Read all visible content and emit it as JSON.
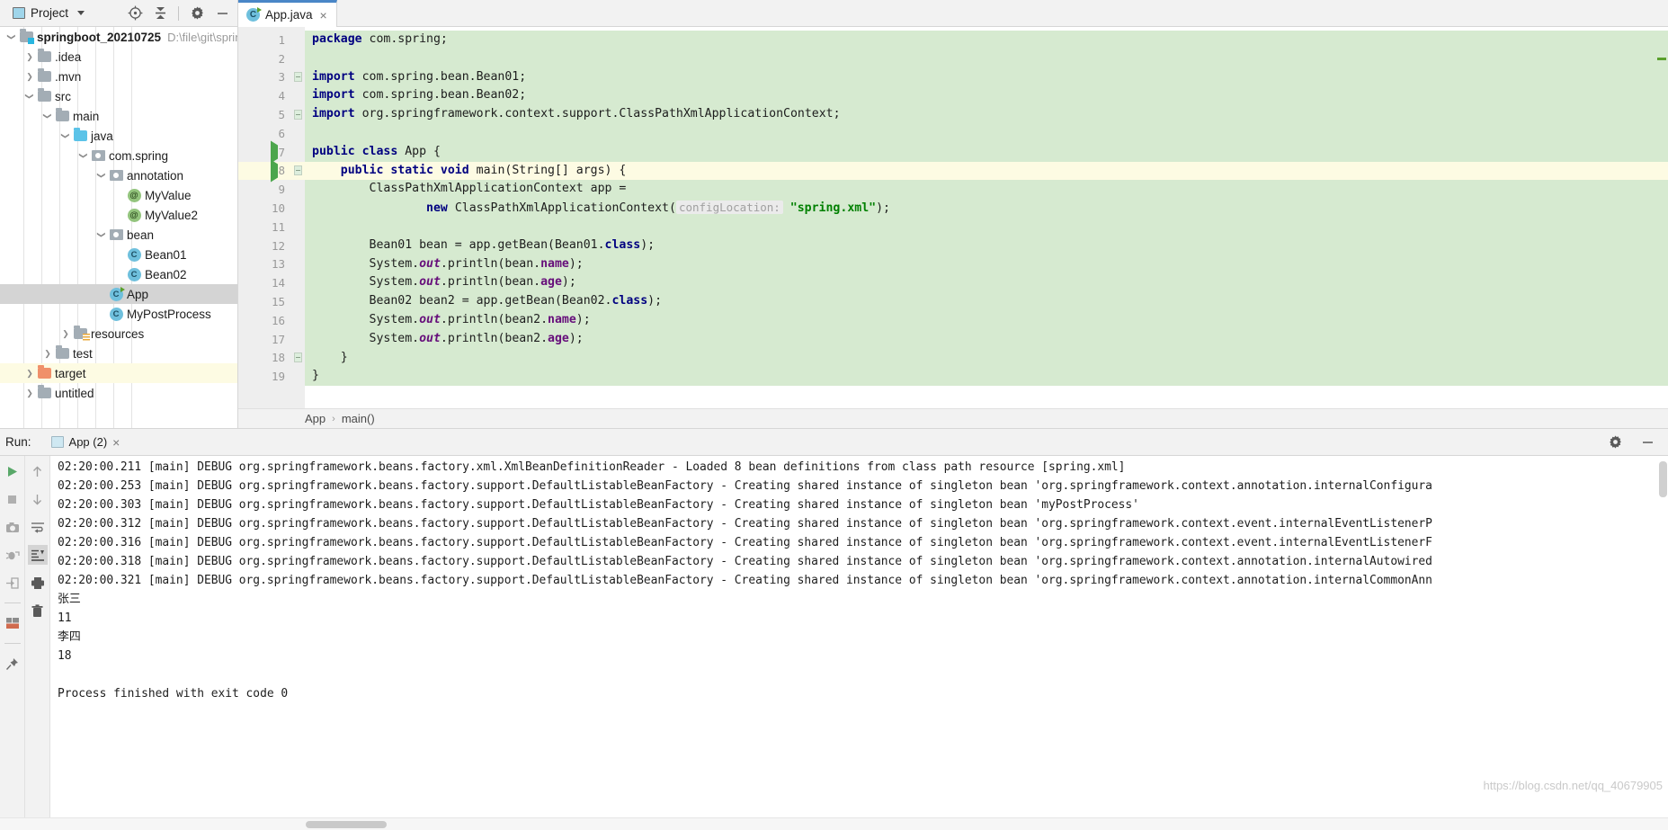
{
  "toolbar": {
    "project_label": "Project",
    "icons": [
      "locate-icon",
      "collapse-all-icon",
      "settings-gear-icon",
      "minimize-icon"
    ]
  },
  "tabs": [
    {
      "label": "App.java",
      "icon": "java-class-runnable-icon",
      "active": true,
      "close": "×"
    }
  ],
  "project_tree": [
    {
      "depth": 0,
      "label": "springboot_20210725",
      "path": "D:\\file\\git\\sprin",
      "icon": "module-folder-icon",
      "arrow": "down",
      "bold": true,
      "state": "normal"
    },
    {
      "depth": 1,
      "label": ".idea",
      "icon": "folder-icon",
      "arrow": "right",
      "bold": false,
      "state": "normal"
    },
    {
      "depth": 1,
      "label": ".mvn",
      "icon": "folder-icon",
      "arrow": "right",
      "bold": false,
      "state": "normal"
    },
    {
      "depth": 1,
      "label": "src",
      "icon": "folder-icon",
      "arrow": "down",
      "bold": false,
      "state": "normal"
    },
    {
      "depth": 2,
      "label": "main",
      "icon": "folder-icon",
      "arrow": "down",
      "bold": false,
      "state": "normal"
    },
    {
      "depth": 3,
      "label": "java",
      "icon": "source-folder-icon",
      "arrow": "down",
      "bold": false,
      "state": "normal"
    },
    {
      "depth": 4,
      "label": "com.spring",
      "icon": "package-icon",
      "arrow": "down",
      "bold": false,
      "state": "normal"
    },
    {
      "depth": 5,
      "label": "annotation",
      "icon": "package-icon",
      "arrow": "down",
      "bold": false,
      "state": "normal"
    },
    {
      "depth": 6,
      "label": "MyValue",
      "icon": "annotation-icon",
      "arrow": "none",
      "bold": false,
      "state": "normal"
    },
    {
      "depth": 6,
      "label": "MyValue2",
      "icon": "annotation-icon",
      "arrow": "none",
      "bold": false,
      "state": "normal"
    },
    {
      "depth": 5,
      "label": "bean",
      "icon": "package-icon",
      "arrow": "down",
      "bold": false,
      "state": "normal"
    },
    {
      "depth": 6,
      "label": "Bean01",
      "icon": "class-icon",
      "arrow": "none",
      "bold": false,
      "state": "normal"
    },
    {
      "depth": 6,
      "label": "Bean02",
      "icon": "class-icon",
      "arrow": "none",
      "bold": false,
      "state": "normal"
    },
    {
      "depth": 5,
      "label": "App",
      "icon": "class-runnable-icon",
      "arrow": "none",
      "bold": false,
      "state": "selected"
    },
    {
      "depth": 5,
      "label": "MyPostProcess",
      "icon": "class-icon",
      "arrow": "none",
      "bold": false,
      "state": "normal"
    },
    {
      "depth": 3,
      "label": "resources",
      "icon": "resources-folder-icon",
      "arrow": "right",
      "bold": false,
      "state": "normal"
    },
    {
      "depth": 2,
      "label": "test",
      "icon": "folder-icon",
      "arrow": "right",
      "bold": false,
      "state": "normal"
    },
    {
      "depth": 1,
      "label": "target",
      "icon": "excluded-folder-icon",
      "arrow": "right",
      "bold": false,
      "state": "highlight"
    },
    {
      "depth": 1,
      "label": "untitled",
      "icon": "folder-icon",
      "arrow": "right",
      "bold": false,
      "state": "normal"
    }
  ],
  "editor": {
    "lines": [
      {
        "n": 1,
        "bg": "green",
        "mark": null,
        "fold": false,
        "tokens": [
          {
            "t": "kw",
            "v": "package"
          },
          {
            "t": "txt",
            "v": " com.spring;"
          }
        ]
      },
      {
        "n": 2,
        "bg": "green",
        "mark": null,
        "fold": false,
        "tokens": []
      },
      {
        "n": 3,
        "bg": "green",
        "mark": null,
        "fold": true,
        "tokens": [
          {
            "t": "kw",
            "v": "import"
          },
          {
            "t": "txt",
            "v": " com.spring.bean.Bean01;"
          }
        ]
      },
      {
        "n": 4,
        "bg": "green",
        "mark": null,
        "fold": false,
        "tokens": [
          {
            "t": "kw",
            "v": "import"
          },
          {
            "t": "txt",
            "v": " com.spring.bean.Bean02;"
          }
        ]
      },
      {
        "n": 5,
        "bg": "green",
        "mark": null,
        "fold": true,
        "tokens": [
          {
            "t": "kw",
            "v": "import"
          },
          {
            "t": "txt",
            "v": " org.springframework.context.support.ClassPathXmlApplicationContext;"
          }
        ]
      },
      {
        "n": 6,
        "bg": "green",
        "mark": null,
        "fold": false,
        "tokens": []
      },
      {
        "n": 7,
        "bg": "green",
        "mark": "run",
        "fold": false,
        "tokens": [
          {
            "t": "kw",
            "v": "public class"
          },
          {
            "t": "txt",
            "v": " App {"
          }
        ]
      },
      {
        "n": 8,
        "bg": "cur",
        "mark": "run",
        "fold": true,
        "tokens": [
          {
            "t": "txt",
            "v": "    "
          },
          {
            "t": "kw",
            "v": "public static void"
          },
          {
            "t": "txt",
            "v": " main(String[] args) {"
          }
        ]
      },
      {
        "n": 9,
        "bg": "green",
        "mark": null,
        "fold": false,
        "tokens": [
          {
            "t": "txt",
            "v": "        ClassPathXmlApplicationContext app ="
          }
        ]
      },
      {
        "n": 10,
        "bg": "green",
        "mark": null,
        "fold": false,
        "tokens": [
          {
            "t": "txt",
            "v": "                "
          },
          {
            "t": "kw",
            "v": "new"
          },
          {
            "t": "txt",
            "v": " ClassPathXmlApplicationContext("
          },
          {
            "t": "hint",
            "v": "configLocation:"
          },
          {
            "t": "txt",
            "v": " "
          },
          {
            "t": "str",
            "v": "\"spring.xml\""
          },
          {
            "t": "txt",
            "v": ");"
          }
        ]
      },
      {
        "n": 11,
        "bg": "green",
        "mark": null,
        "fold": false,
        "tokens": []
      },
      {
        "n": 12,
        "bg": "green",
        "mark": null,
        "fold": false,
        "tokens": [
          {
            "t": "txt",
            "v": "        Bean01 bean = app.getBean(Bean01."
          },
          {
            "t": "kw",
            "v": "class"
          },
          {
            "t": "txt",
            "v": ");"
          }
        ]
      },
      {
        "n": 13,
        "bg": "green",
        "mark": null,
        "fold": false,
        "tokens": [
          {
            "t": "txt",
            "v": "        System."
          },
          {
            "t": "stat",
            "v": "out"
          },
          {
            "t": "txt",
            "v": ".println(bean."
          },
          {
            "t": "fld",
            "v": "name"
          },
          {
            "t": "txt",
            "v": ");"
          }
        ]
      },
      {
        "n": 14,
        "bg": "green",
        "mark": null,
        "fold": false,
        "tokens": [
          {
            "t": "txt",
            "v": "        System."
          },
          {
            "t": "stat",
            "v": "out"
          },
          {
            "t": "txt",
            "v": ".println(bean."
          },
          {
            "t": "fld",
            "v": "age"
          },
          {
            "t": "txt",
            "v": ");"
          }
        ]
      },
      {
        "n": 15,
        "bg": "green",
        "mark": null,
        "fold": false,
        "tokens": [
          {
            "t": "txt",
            "v": "        Bean02 bean2 = app.getBean(Bean02."
          },
          {
            "t": "kw",
            "v": "class"
          },
          {
            "t": "txt",
            "v": ");"
          }
        ]
      },
      {
        "n": 16,
        "bg": "green",
        "mark": null,
        "fold": false,
        "tokens": [
          {
            "t": "txt",
            "v": "        System."
          },
          {
            "t": "stat",
            "v": "out"
          },
          {
            "t": "txt",
            "v": ".println(bean2."
          },
          {
            "t": "fld",
            "v": "name"
          },
          {
            "t": "txt",
            "v": ");"
          }
        ]
      },
      {
        "n": 17,
        "bg": "green",
        "mark": null,
        "fold": false,
        "tokens": [
          {
            "t": "txt",
            "v": "        System."
          },
          {
            "t": "stat",
            "v": "out"
          },
          {
            "t": "txt",
            "v": ".println(bean2."
          },
          {
            "t": "fld",
            "v": "age"
          },
          {
            "t": "txt",
            "v": ");"
          }
        ]
      },
      {
        "n": 18,
        "bg": "green",
        "mark": null,
        "fold": true,
        "tokens": [
          {
            "t": "txt",
            "v": "    }"
          }
        ]
      },
      {
        "n": 19,
        "bg": "green",
        "mark": null,
        "fold": false,
        "tokens": [
          {
            "t": "txt",
            "v": "}"
          }
        ]
      }
    ],
    "breadcrumb": {
      "items": [
        "App",
        "main()"
      ],
      "separator": "›"
    }
  },
  "run_panel": {
    "title": "Run:",
    "tab_label": "App (2)",
    "tab_close": "×",
    "left_tools": [
      "rerun-icon",
      "stop-icon",
      "camera-icon",
      "debug-icon",
      "export-icon",
      "layout-icon",
      "pin-icon"
    ],
    "right_tools": [
      "scroll-up-icon",
      "scroll-down-icon",
      "soft-wrap-icon",
      "scroll-to-end-icon",
      "print-icon",
      "trash-icon"
    ],
    "header_icons": [
      "settings-gear-icon",
      "hide-icon"
    ],
    "console_lines": [
      "02:20:00.211 [main] DEBUG org.springframework.beans.factory.xml.XmlBeanDefinitionReader - Loaded 8 bean definitions from class path resource [spring.xml]",
      "02:20:00.253 [main] DEBUG org.springframework.beans.factory.support.DefaultListableBeanFactory - Creating shared instance of singleton bean 'org.springframework.context.annotation.internalConfigura",
      "02:20:00.303 [main] DEBUG org.springframework.beans.factory.support.DefaultListableBeanFactory - Creating shared instance of singleton bean 'myPostProcess'",
      "02:20:00.312 [main] DEBUG org.springframework.beans.factory.support.DefaultListableBeanFactory - Creating shared instance of singleton bean 'org.springframework.context.event.internalEventListenerP",
      "02:20:00.316 [main] DEBUG org.springframework.beans.factory.support.DefaultListableBeanFactory - Creating shared instance of singleton bean 'org.springframework.context.event.internalEventListenerF",
      "02:20:00.318 [main] DEBUG org.springframework.beans.factory.support.DefaultListableBeanFactory - Creating shared instance of singleton bean 'org.springframework.context.annotation.internalAutowired",
      "02:20:00.321 [main] DEBUG org.springframework.beans.factory.support.DefaultListableBeanFactory - Creating shared instance of singleton bean 'org.springframework.context.annotation.internalCommonAnn",
      "张三",
      "11",
      "李四",
      "18",
      "",
      "Process finished with exit code 0"
    ],
    "watermark": "https://blog.csdn.net/qq_40679905"
  },
  "colors": {
    "accent": "#4a86c7",
    "code_bg_green": "#d6ead0",
    "current_line": "#fdfbe3",
    "keyword": "#000080",
    "string": "#008000",
    "field": "#660e7a",
    "selection": "#d4d4d4"
  }
}
